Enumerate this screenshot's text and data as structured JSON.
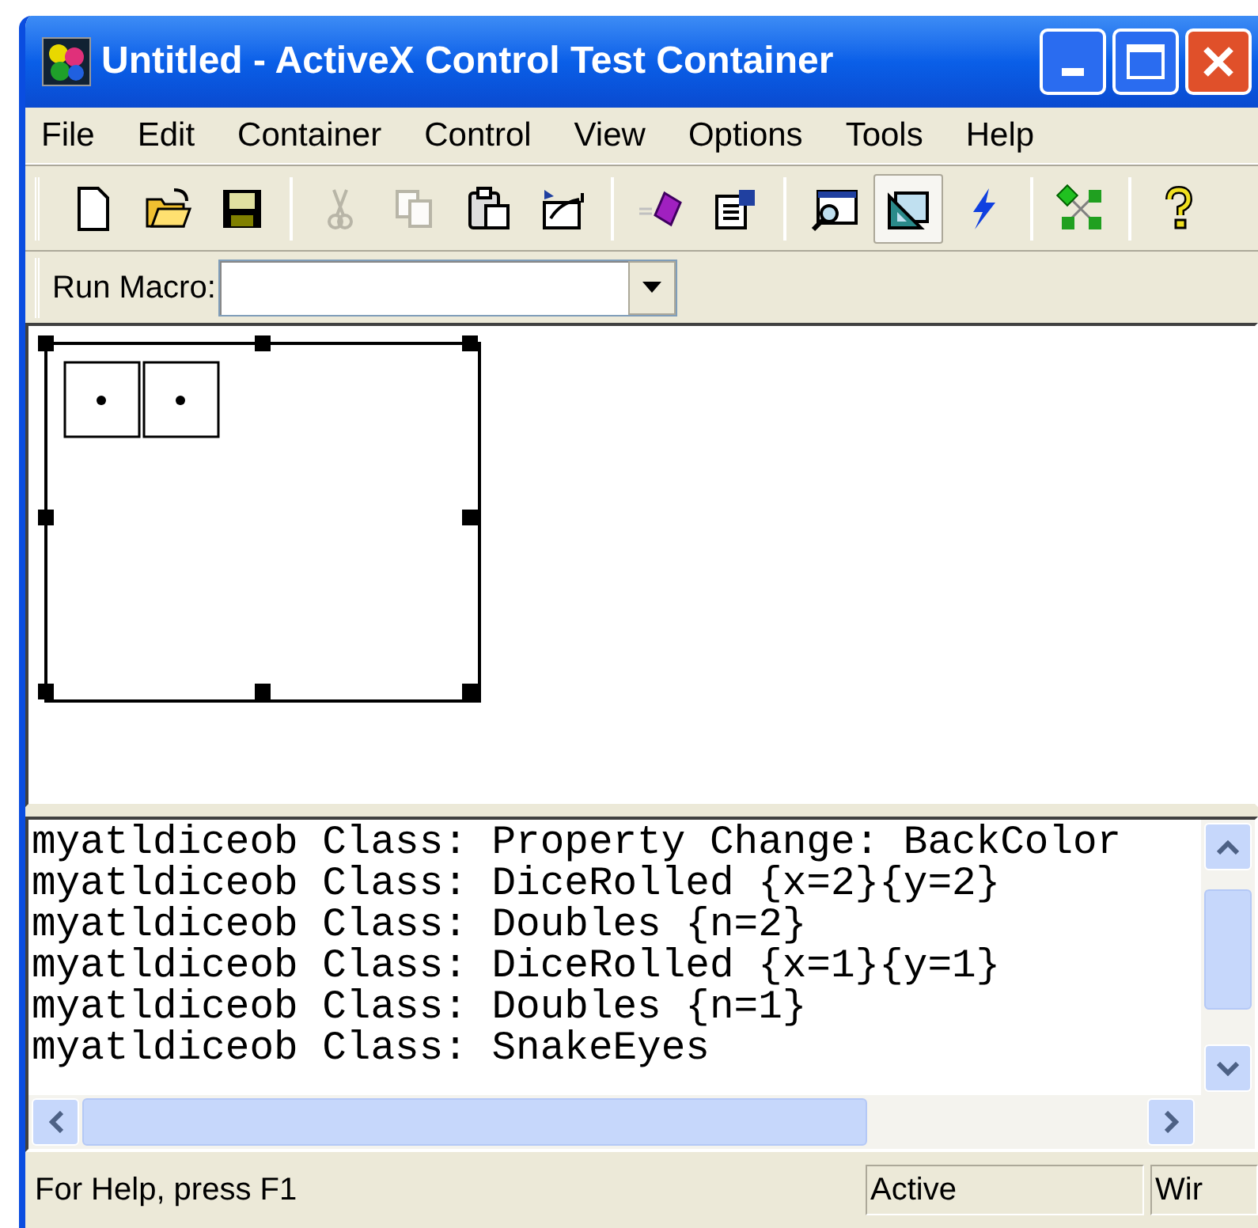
{
  "window": {
    "title": "Untitled - ActiveX Control Test Container"
  },
  "menu": [
    "File",
    "Edit",
    "Container",
    "Control",
    "View",
    "Options",
    "Tools",
    "Help"
  ],
  "toolbar": [
    {
      "kind": "new",
      "disabled": false,
      "pressed": false
    },
    {
      "kind": "open",
      "disabled": false,
      "pressed": false
    },
    {
      "kind": "save",
      "disabled": false,
      "pressed": false
    },
    {
      "kind": "separator"
    },
    {
      "kind": "cut",
      "disabled": true,
      "pressed": false
    },
    {
      "kind": "copy",
      "disabled": true,
      "pressed": false
    },
    {
      "kind": "paste",
      "disabled": false,
      "pressed": false
    },
    {
      "kind": "paste-special",
      "disabled": false,
      "pressed": false
    },
    {
      "kind": "separator"
    },
    {
      "kind": "invoke",
      "disabled": false,
      "pressed": false
    },
    {
      "kind": "properties",
      "disabled": false,
      "pressed": false
    },
    {
      "kind": "separator"
    },
    {
      "kind": "find",
      "disabled": false,
      "pressed": false
    },
    {
      "kind": "design",
      "disabled": false,
      "pressed": true
    },
    {
      "kind": "events",
      "disabled": false,
      "pressed": false
    },
    {
      "kind": "separator"
    },
    {
      "kind": "graph",
      "disabled": false,
      "pressed": false
    },
    {
      "kind": "separator"
    },
    {
      "kind": "help",
      "disabled": false,
      "pressed": false
    }
  ],
  "macro_bar": {
    "label": "Run Macro:"
  },
  "log": [
    "myatldiceob Class: Property Change: BackColor",
    "myatldiceob Class: DiceRolled {x=2}{y=2}",
    "myatldiceob Class: Doubles {n=2}",
    "myatldiceob Class: DiceRolled {x=1}{y=1}",
    "myatldiceob Class: Doubles {n=1}",
    "myatldiceob Class: SnakeEyes"
  ],
  "status_bar": [
    "For Help, press F1",
    "Active",
    "Wir"
  ]
}
